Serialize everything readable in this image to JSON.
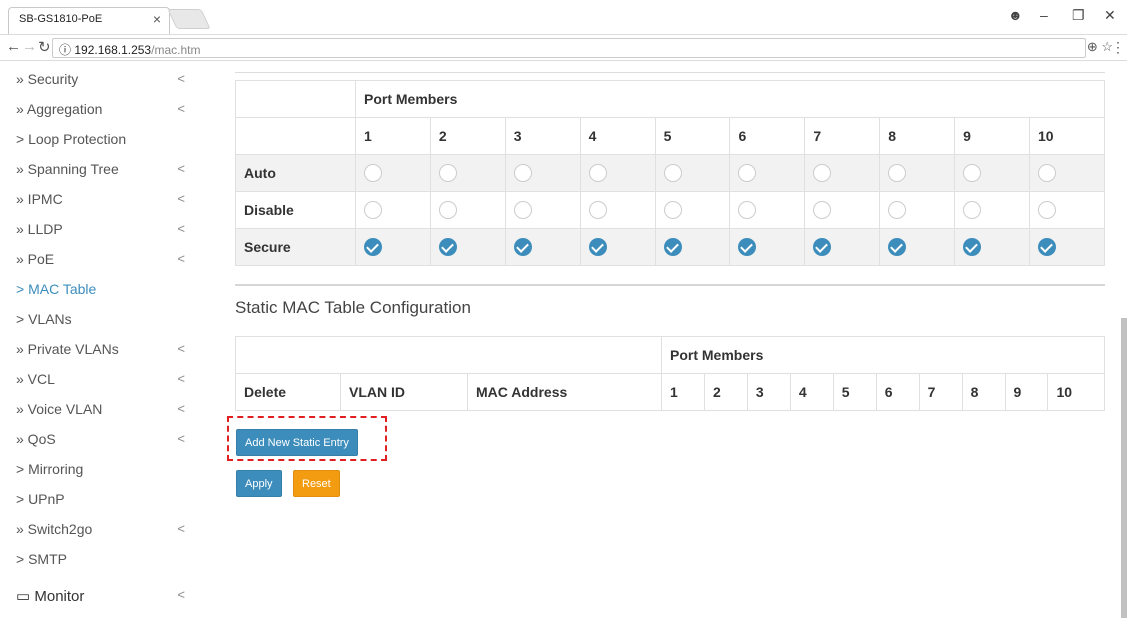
{
  "browser": {
    "tab_title": "SB-GS1810-PoE",
    "tab_close": "×",
    "url_host": "192.168.1.253",
    "url_path": "/mac.htm",
    "info_icon": "ⓘ",
    "zoom_icon": "⊕",
    "star_icon": "☆"
  },
  "sidebar": {
    "items": [
      {
        "label": "» Security",
        "chevron": "<"
      },
      {
        "label": "» Aggregation",
        "chevron": "<"
      },
      {
        "label": "> Loop Protection",
        "chevron": ""
      },
      {
        "label": "» Spanning Tree",
        "chevron": "<"
      },
      {
        "label": "» IPMC",
        "chevron": "<"
      },
      {
        "label": "» LLDP",
        "chevron": "<"
      },
      {
        "label": "» PoE",
        "chevron": "<"
      },
      {
        "label": "> MAC Table",
        "chevron": ""
      },
      {
        "label": "> VLANs",
        "chevron": ""
      },
      {
        "label": "» Private VLANs",
        "chevron": "<"
      },
      {
        "label": "» VCL",
        "chevron": "<"
      },
      {
        "label": "» Voice VLAN",
        "chevron": "<"
      },
      {
        "label": "» QoS",
        "chevron": "<"
      },
      {
        "label": "> Mirroring",
        "chevron": ""
      },
      {
        "label": "> UPnP",
        "chevron": ""
      },
      {
        "label": "» Switch2go",
        "chevron": "<"
      },
      {
        "label": "> SMTP",
        "chevron": ""
      }
    ],
    "monitor": {
      "label": "Monitor",
      "chevron": "<"
    },
    "active_color": "#3c8dbc"
  },
  "learning_table": {
    "header": "Port Members",
    "ports": [
      "1",
      "2",
      "3",
      "4",
      "5",
      "6",
      "7",
      "8",
      "9",
      "10"
    ],
    "rows": [
      {
        "label": "Auto",
        "selected": false
      },
      {
        "label": "Disable",
        "selected": false
      },
      {
        "label": "Secure",
        "selected": true
      }
    ]
  },
  "static_table": {
    "title": "Static MAC Table Configuration",
    "port_header": "Port Members",
    "col_delete": "Delete",
    "col_vlan": "VLAN ID",
    "col_mac": "MAC Address",
    "ports": [
      "1",
      "2",
      "3",
      "4",
      "5",
      "6",
      "7",
      "8",
      "9",
      "10"
    ]
  },
  "buttons": {
    "add_new": "Add New Static Entry",
    "apply": "Apply",
    "reset": "Reset"
  },
  "colors": {
    "primary": "#3c8dbc",
    "warning": "#f39c12",
    "highlight": "#e02020"
  }
}
